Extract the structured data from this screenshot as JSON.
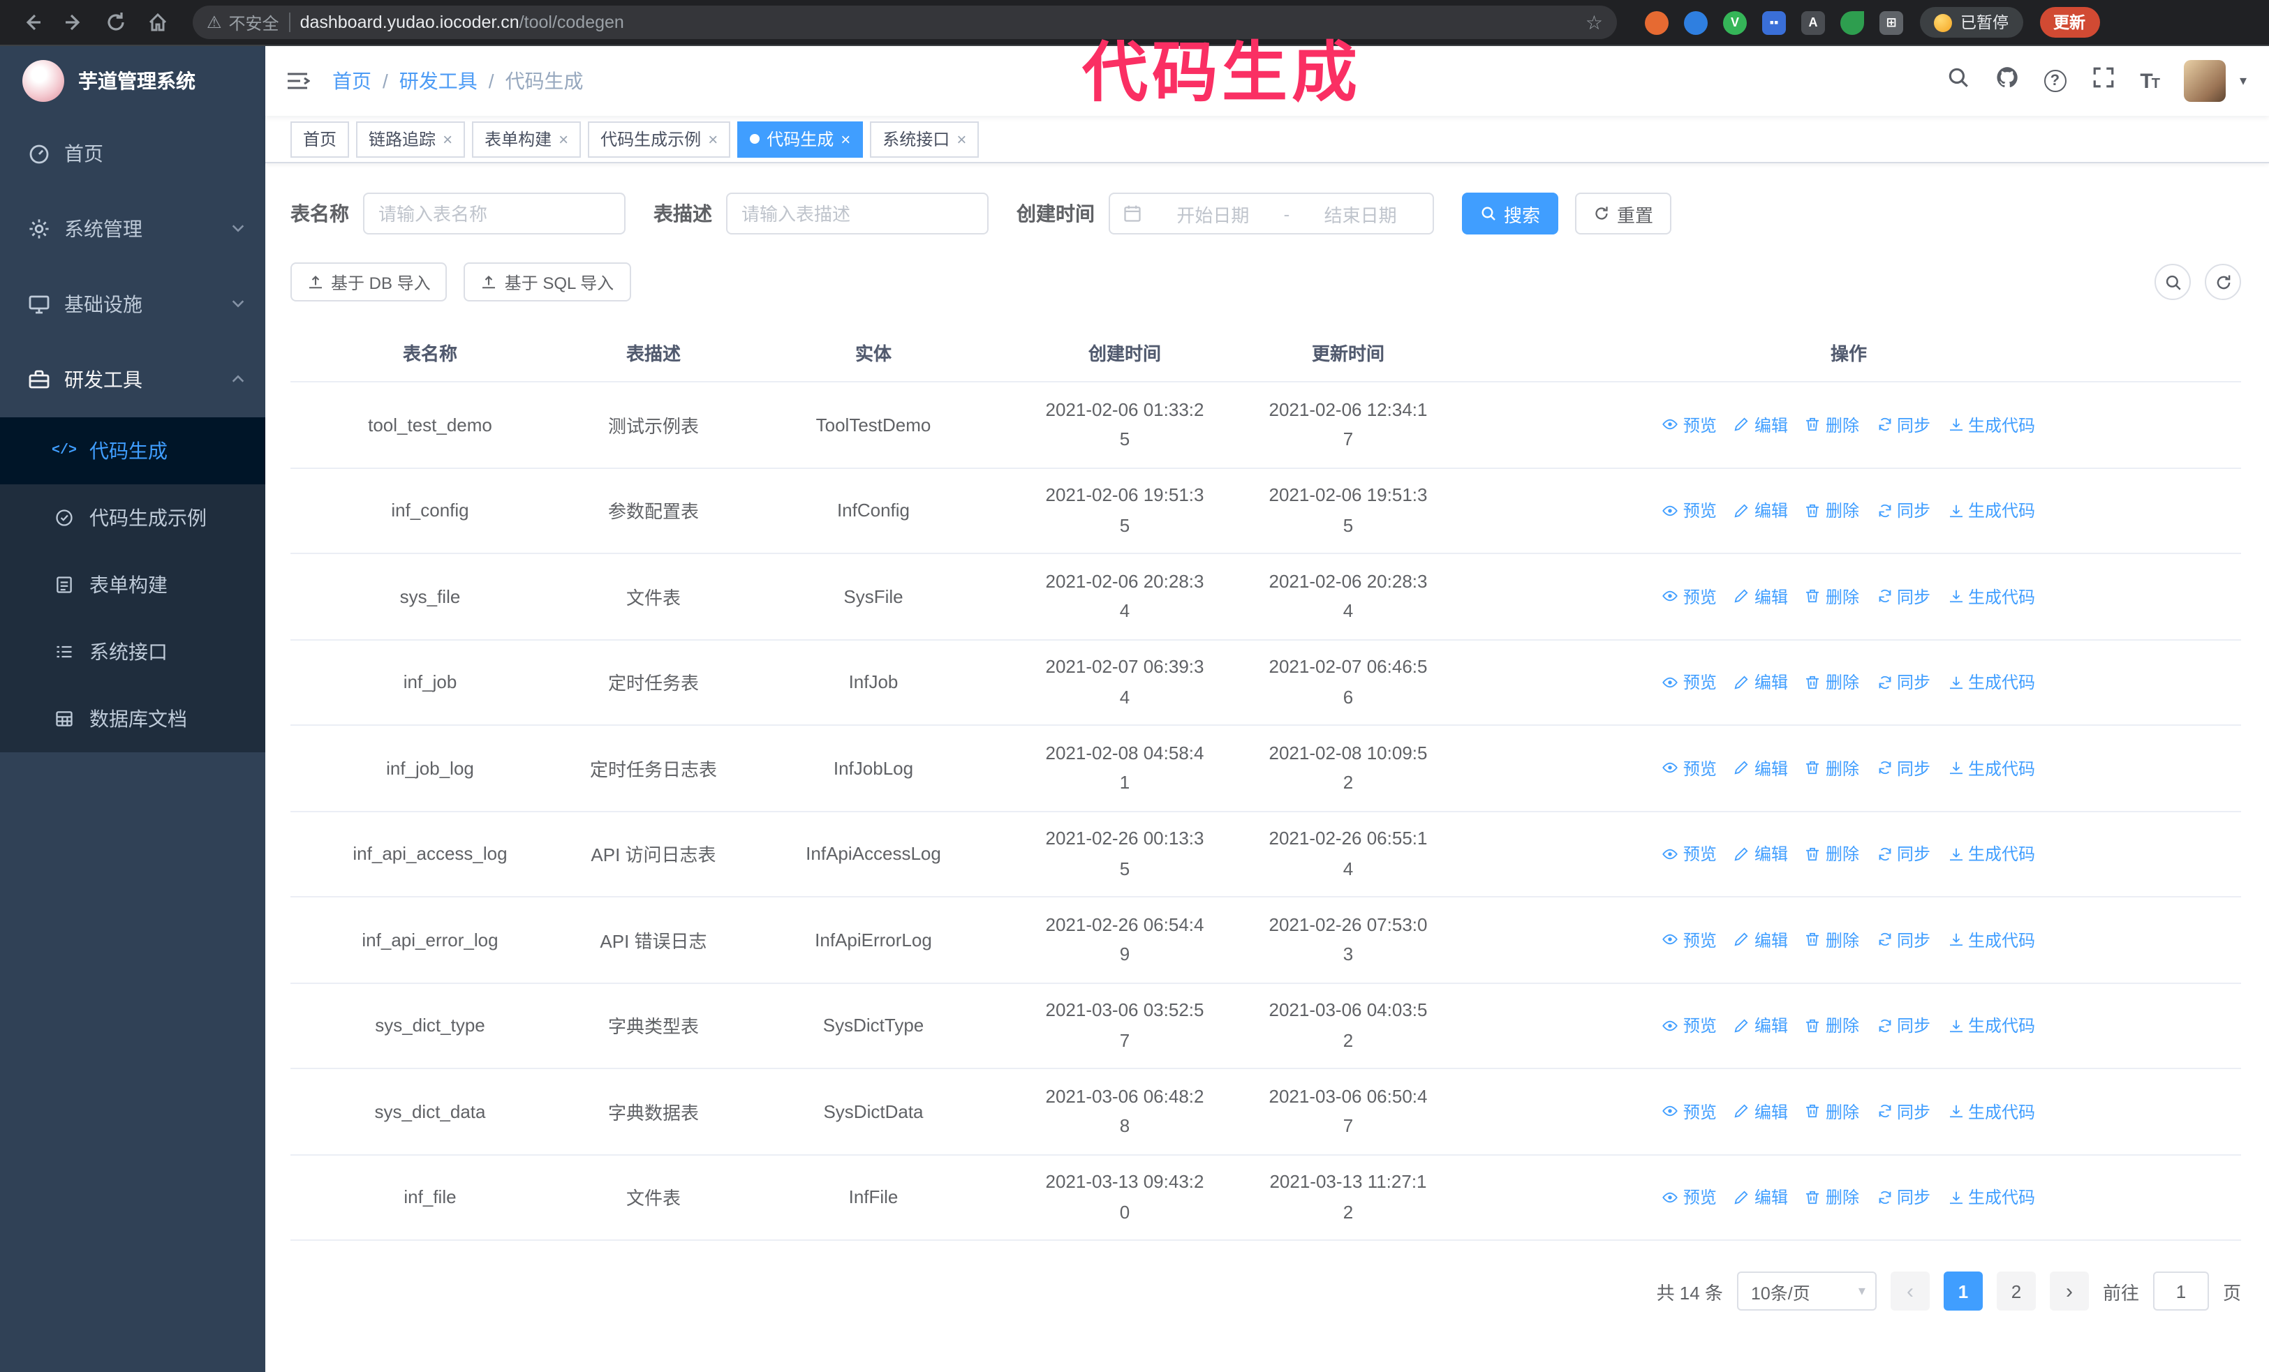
{
  "colors": {
    "accent": "#409eff",
    "annotation": "#fa2f63",
    "update_button": "#d14a33"
  },
  "annotation": {
    "text": "代码生成"
  },
  "browser": {
    "security_label": "不安全",
    "url_host": "dashboard.yudao.iocoder.cn",
    "url_path": "/tool/codegen",
    "paused_badge": "已暂停",
    "update_button": "更新"
  },
  "sidebar": {
    "logo_title": "芋道管理系统",
    "items": [
      "首页",
      "系统管理",
      "基础设施",
      "研发工具"
    ],
    "sub_items": [
      "代码生成",
      "代码生成示例",
      "表单构建",
      "系统接口",
      "数据库文档"
    ]
  },
  "header": {
    "breadcrumb": [
      "首页",
      "研发工具",
      "代码生成"
    ],
    "breadcrumb_separator": "/"
  },
  "tabs": [
    "首页",
    "链路追踪",
    "表单构建",
    "代码生成示例",
    "代码生成",
    "系统接口"
  ],
  "filters": {
    "table_name_label": "表名称",
    "table_name_placeholder": "请输入表名称",
    "table_desc_label": "表描述",
    "table_desc_placeholder": "请输入表描述",
    "create_time_label": "创建时间",
    "date_start_placeholder": "开始日期",
    "date_separator": "-",
    "date_end_placeholder": "结束日期",
    "search_button": "搜索",
    "reset_button": "重置"
  },
  "toolbar": {
    "import_db_button": "基于 DB 导入",
    "import_sql_button": "基于 SQL 导入"
  },
  "table": {
    "columns": [
      "表名称",
      "表描述",
      "实体",
      "创建时间",
      "更新时间",
      "操作"
    ],
    "action_labels": [
      "预览",
      "编辑",
      "删除",
      "同步",
      "生成代码"
    ],
    "rows": [
      {
        "name": "tool_test_demo",
        "desc": "测试示例表",
        "entity": "ToolTestDemo",
        "create_time": "2021-02-06 01:33:25",
        "update_time": "2021-02-06 12:34:17"
      },
      {
        "name": "inf_config",
        "desc": "参数配置表",
        "entity": "InfConfig",
        "create_time": "2021-02-06 19:51:35",
        "update_time": "2021-02-06 19:51:35"
      },
      {
        "name": "sys_file",
        "desc": "文件表",
        "entity": "SysFile",
        "create_time": "2021-02-06 20:28:34",
        "update_time": "2021-02-06 20:28:34"
      },
      {
        "name": "inf_job",
        "desc": "定时任务表",
        "entity": "InfJob",
        "create_time": "2021-02-07 06:39:34",
        "update_time": "2021-02-07 06:46:56"
      },
      {
        "name": "inf_job_log",
        "desc": "定时任务日志表",
        "entity": "InfJobLog",
        "create_time": "2021-02-08 04:58:41",
        "update_time": "2021-02-08 10:09:52"
      },
      {
        "name": "inf_api_access_log",
        "desc": "API 访问日志表",
        "entity": "InfApiAccessLog",
        "create_time": "2021-02-26 00:13:35",
        "update_time": "2021-02-26 06:55:14"
      },
      {
        "name": "inf_api_error_log",
        "desc": "API 错误日志",
        "entity": "InfApiErrorLog",
        "create_time": "2021-02-26 06:54:49",
        "update_time": "2021-02-26 07:53:03"
      },
      {
        "name": "sys_dict_type",
        "desc": "字典类型表",
        "entity": "SysDictType",
        "create_time": "2021-03-06 03:52:57",
        "update_time": "2021-03-06 04:03:52"
      },
      {
        "name": "sys_dict_data",
        "desc": "字典数据表",
        "entity": "SysDictData",
        "create_time": "2021-03-06 06:48:28",
        "update_time": "2021-03-06 06:50:47"
      },
      {
        "name": "inf_file",
        "desc": "文件表",
        "entity": "InfFile",
        "create_time": "2021-03-13 09:43:20",
        "update_time": "2021-03-13 11:27:12"
      }
    ]
  },
  "pagination": {
    "total_text": "共 14 条",
    "page_size": "10条/页",
    "pages": [
      "1",
      "2"
    ],
    "goto_label": "前往",
    "goto_value": "1",
    "goto_suffix": "页"
  }
}
